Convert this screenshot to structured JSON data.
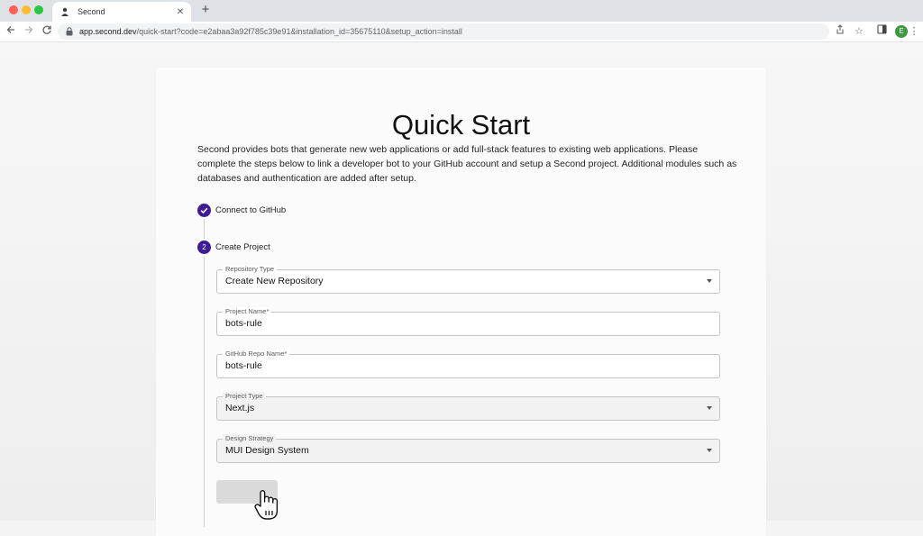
{
  "browser": {
    "tab": {
      "title": "Second"
    },
    "new_tab_glyph": "+",
    "url_host": "app.second.dev",
    "url_path": "/quick-start?code=e2abaa3a92f785c39e91&installation_id=35675110&setup_action=install",
    "profile_initial": "E",
    "icons": [
      "back-icon",
      "forward-icon",
      "reload-icon",
      "lock-icon",
      "share-icon",
      "star-icon",
      "sidepanel-icon",
      "menu-icon"
    ]
  },
  "page": {
    "title": "Quick Start",
    "intro": "Second provides bots that generate new web applications or add full-stack features to existing web applications. Please complete the steps below to link a developer bot to your GitHub account and setup a Second project. Additional modules such as databases and authentication are added after setup.",
    "steps": [
      {
        "label": "Connect to GitHub",
        "status": "completed"
      },
      {
        "number": "2",
        "label": "Create Project",
        "status": "active"
      }
    ],
    "form": {
      "repository_type": {
        "label": "Repository Type",
        "value": "Create New Repository"
      },
      "project_name": {
        "label": "Project Name",
        "required_mark": "*",
        "value": "bots-rule"
      },
      "github_repo_name": {
        "label": "GitHub Repo Name",
        "required_mark": "*",
        "value": "bots-rule"
      },
      "project_type": {
        "label": "Project Type",
        "value": "Next.js"
      },
      "design_strategy": {
        "label": "Design Strategy",
        "value": "MUI Design System"
      }
    }
  },
  "colors": {
    "step_icon": "#3b1d97",
    "page_background": "#f4f4f4"
  }
}
